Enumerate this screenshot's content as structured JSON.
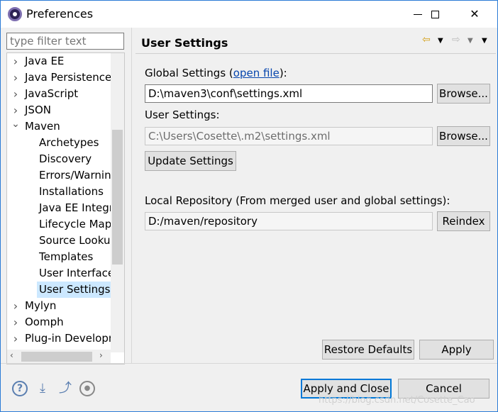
{
  "window": {
    "title": "Preferences"
  },
  "filter": {
    "placeholder": "type filter text"
  },
  "tree": {
    "items": [
      {
        "label": "Java EE",
        "indent": 0,
        "arrow": ">"
      },
      {
        "label": "Java Persistence",
        "indent": 0,
        "arrow": ">"
      },
      {
        "label": "JavaScript",
        "indent": 0,
        "arrow": ">"
      },
      {
        "label": "JSON",
        "indent": 0,
        "arrow": ">"
      },
      {
        "label": "Maven",
        "indent": 0,
        "arrow": "v"
      },
      {
        "label": "Archetypes",
        "indent": 1,
        "arrow": ""
      },
      {
        "label": "Discovery",
        "indent": 1,
        "arrow": ""
      },
      {
        "label": "Errors/Warnings",
        "indent": 1,
        "arrow": ""
      },
      {
        "label": "Installations",
        "indent": 1,
        "arrow": ""
      },
      {
        "label": "Java EE Integration",
        "indent": 1,
        "arrow": ""
      },
      {
        "label": "Lifecycle Mappings",
        "indent": 1,
        "arrow": ""
      },
      {
        "label": "Source Lookup",
        "indent": 1,
        "arrow": ""
      },
      {
        "label": "Templates",
        "indent": 1,
        "arrow": ""
      },
      {
        "label": "User Interface",
        "indent": 1,
        "arrow": ""
      },
      {
        "label": "User Settings",
        "indent": 1,
        "arrow": "",
        "selected": true
      },
      {
        "label": "Mylyn",
        "indent": 0,
        "arrow": ">"
      },
      {
        "label": "Oomph",
        "indent": 0,
        "arrow": ">"
      },
      {
        "label": "Plug-in Development",
        "indent": 0,
        "arrow": ">"
      }
    ]
  },
  "page": {
    "title": "User Settings",
    "global_label_prefix": "Global Settings (",
    "global_link": "open file",
    "global_label_suffix": "):",
    "global_value": "D:\\maven3\\conf\\settings.xml",
    "browse1": "Browse...",
    "user_label": "User Settings:",
    "user_value": "C:\\Users\\Cosette\\.m2\\settings.xml",
    "browse2": "Browse...",
    "update_button": "Update Settings",
    "local_repo_label": "Local Repository (From merged user and global settings):",
    "local_repo_value": "D:/maven/repository",
    "reindex_button": "Reindex",
    "restore_defaults": "Restore Defaults",
    "apply": "Apply"
  },
  "footer": {
    "apply_close": "Apply and Close",
    "cancel": "Cancel",
    "watermark": "https://blog.csdn.net/Cosette_Cao"
  }
}
